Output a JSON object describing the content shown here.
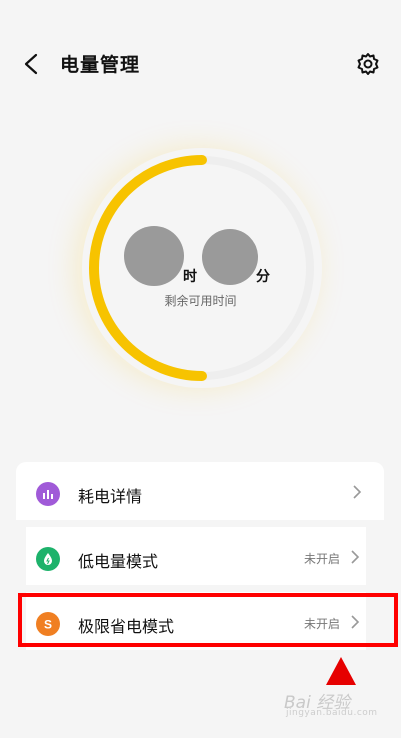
{
  "header": {
    "title": "电量管理"
  },
  "battery": {
    "hour_unit": "时",
    "minute_unit": "分",
    "remaining_label": "剩余可用时间",
    "level_fraction": 0.5,
    "accent_color": "#f7c300"
  },
  "menu": {
    "items": [
      {
        "label": "耗电详情",
        "status": "",
        "icon": "bar-chart-icon",
        "icon_color": "#a05ad8",
        "icon_glyph": ""
      },
      {
        "label": "低电量模式",
        "status": "未开启",
        "icon": "drop-icon",
        "icon_color": "#1db26b",
        "icon_glyph": ""
      },
      {
        "label": "极限省电模式",
        "status": "未开启",
        "icon": "s-icon",
        "icon_color": "#f07f22",
        "icon_glyph": "S"
      }
    ]
  },
  "annotation": {
    "highlight_color": "#ff0000"
  },
  "watermark": {
    "text": "Bai 经验",
    "subtext": "jingyan.baidu.com"
  }
}
